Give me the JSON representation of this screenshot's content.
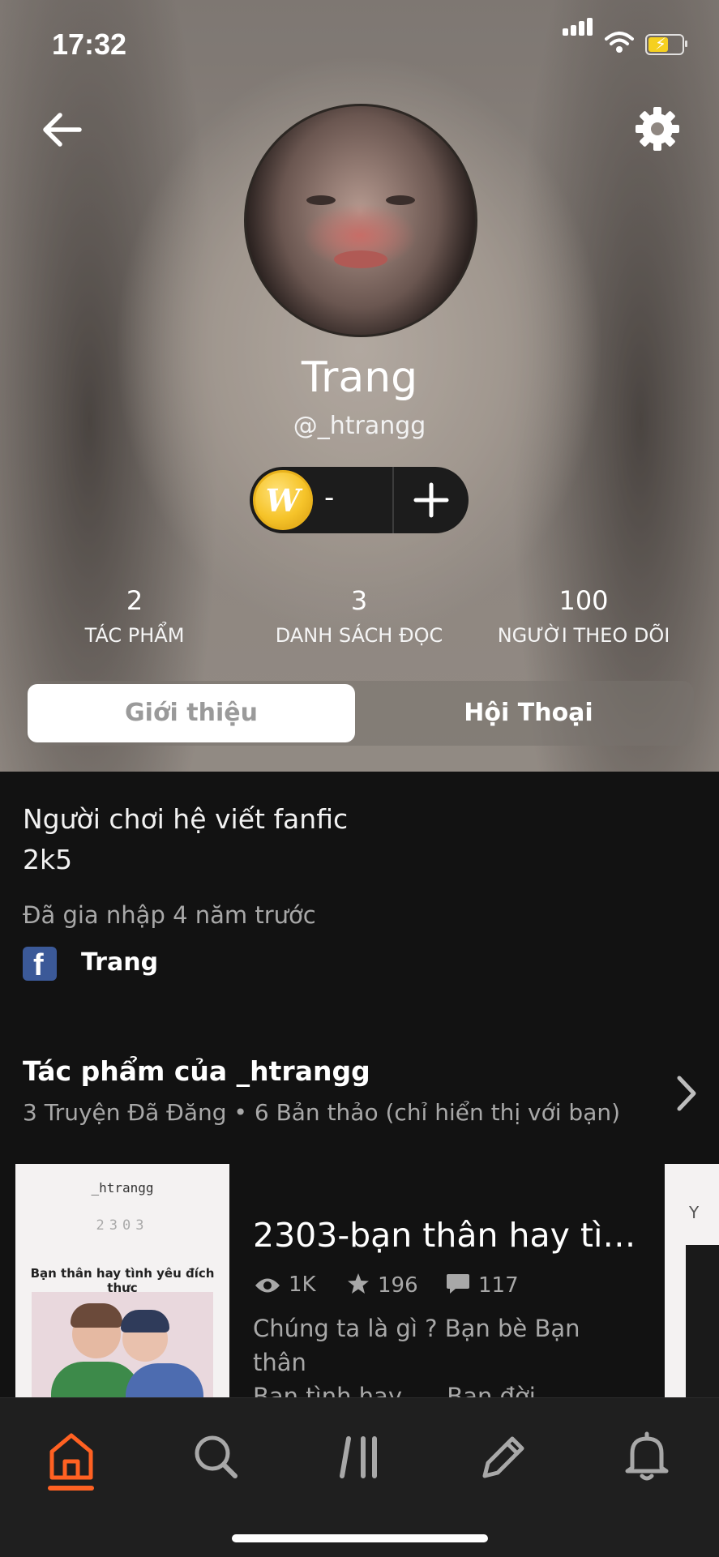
{
  "status_bar": {
    "time": "17:32"
  },
  "profile": {
    "name": "Trang",
    "handle": "@_htrangg",
    "coins_value": "-"
  },
  "stats": [
    {
      "value": "2",
      "label": "TÁC PHẨM"
    },
    {
      "value": "3",
      "label": "DANH SÁCH ĐỌC"
    },
    {
      "value": "100",
      "label": "NGƯỜI THEO DÕI"
    }
  ],
  "tabs": {
    "about": "Giới thiệu",
    "conversations": "Hội Thoại",
    "active": "about"
  },
  "about": {
    "bio_line1": "Người chơi hệ viết fanfic",
    "bio_line2": "2k5",
    "joined": "Đã gia nhập 4 năm trước",
    "facebook_name": "Trang"
  },
  "works": {
    "title": "Tác phẩm của _htrangg",
    "subtitle": "3 Truyện Đã Đăng • 6 Bản thảo (chỉ hiển thị với bạn)",
    "stories": [
      {
        "title": "2303-bạn thân hay tì…",
        "views": "1K",
        "votes": "196",
        "comments": "117",
        "description_line1": "Chúng ta là gì ?  Bạn bè Bạn thân",
        "description_line2": "Bạn tình hay .... Bạn đời",
        "cover": {
          "author": "_htrangg",
          "code": "2303",
          "title": "Bạn thân hay tình yêu đích thực"
        }
      }
    ],
    "next_cover_letter": "Y"
  },
  "tab_bar": {
    "items": [
      "home-icon",
      "search-icon",
      "library-icon",
      "write-icon",
      "notifications-icon"
    ],
    "active": "home-icon",
    "accent_color": "#ff6122"
  },
  "colors": {
    "background": "#121212",
    "facebook": "#3b5998",
    "coin": "#f6c42a"
  }
}
